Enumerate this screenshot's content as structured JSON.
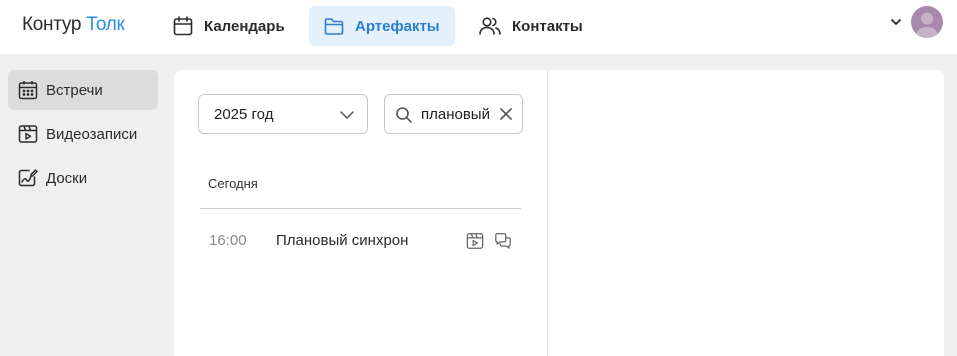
{
  "header": {
    "logo_part1": "Контур",
    "logo_part2": "Толк",
    "nav": [
      {
        "label": "Календарь",
        "icon": "calendar-icon"
      },
      {
        "label": "Артефакты",
        "icon": "folder-icon",
        "active": true
      },
      {
        "label": "Контакты",
        "icon": "contacts-icon"
      }
    ]
  },
  "sidebar": {
    "items": [
      {
        "label": "Встречи",
        "icon": "calendar-grid-icon",
        "active": true
      },
      {
        "label": "Видеозаписи",
        "icon": "video-icon"
      },
      {
        "label": "Доски",
        "icon": "board-icon"
      }
    ]
  },
  "filters": {
    "year": "2025 год",
    "search_value": "плановый"
  },
  "list": {
    "section": "Сегодня",
    "items": [
      {
        "time": "16:00",
        "title": "Плановый синхрон",
        "icons": [
          "video-icon",
          "chat-icon"
        ]
      }
    ]
  },
  "colors": {
    "accent": "#2d8ee0",
    "active_nav_bg": "#e4f0fc",
    "active_side_bg": "#dcdcdc",
    "page_bg": "#efefef"
  }
}
